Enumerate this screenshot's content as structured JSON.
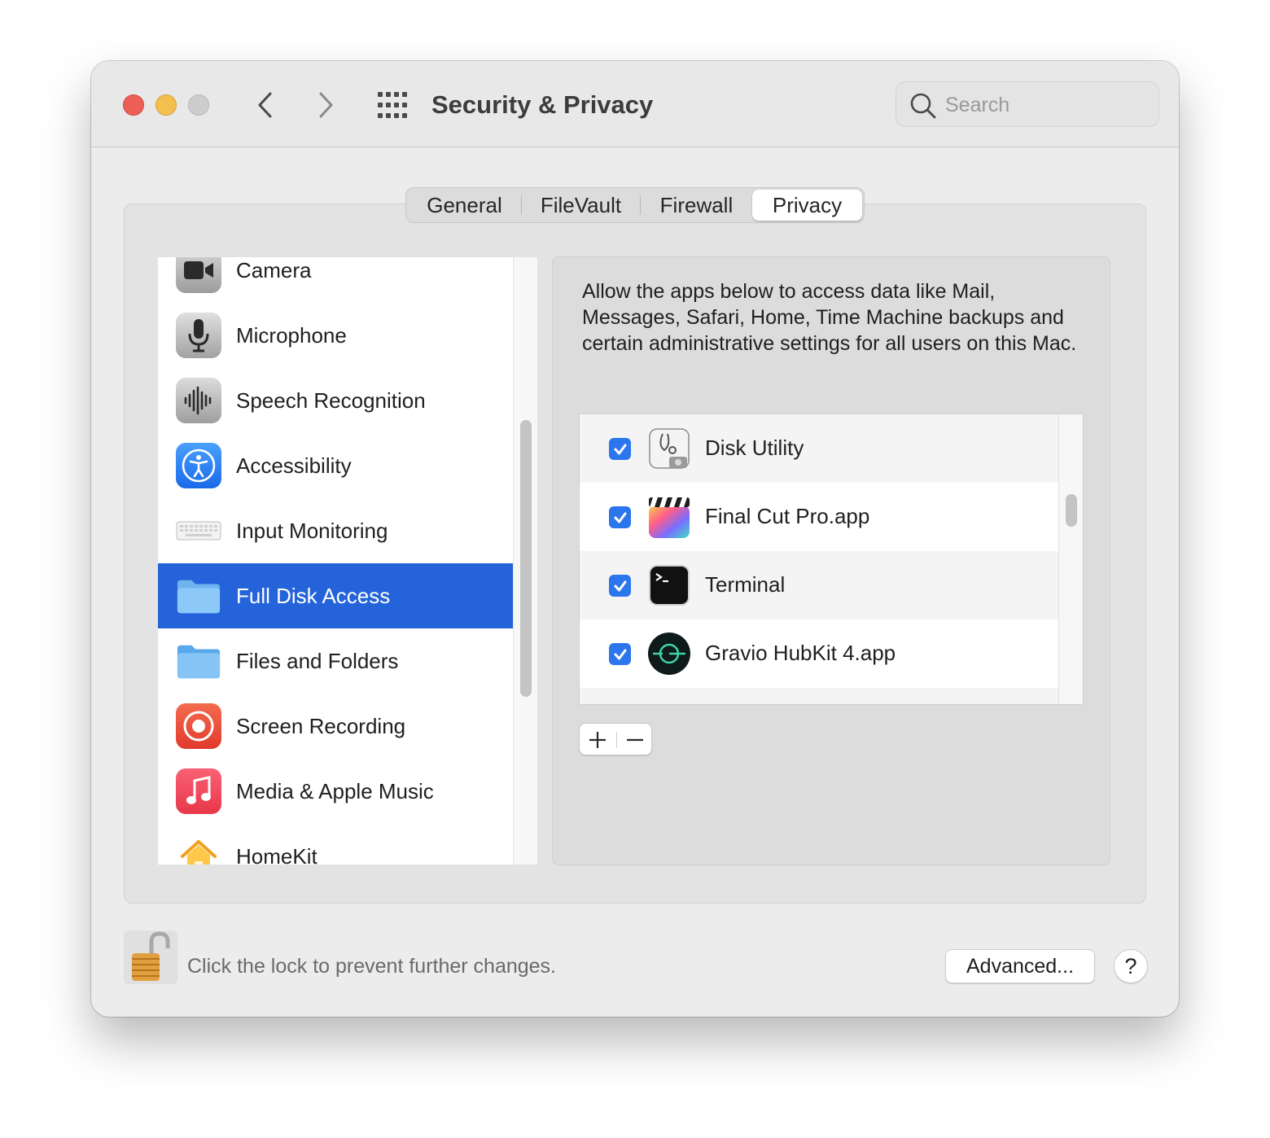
{
  "window": {
    "title": "Security & Privacy",
    "search_placeholder": "Search"
  },
  "tabs": [
    {
      "label": "General",
      "active": false
    },
    {
      "label": "FileVault",
      "active": false
    },
    {
      "label": "Firewall",
      "active": false
    },
    {
      "label": "Privacy",
      "active": true
    }
  ],
  "categories": [
    {
      "label": "Camera",
      "icon": "camera-icon"
    },
    {
      "label": "Microphone",
      "icon": "microphone-icon"
    },
    {
      "label": "Speech Recognition",
      "icon": "waveform-icon"
    },
    {
      "label": "Accessibility",
      "icon": "accessibility-icon"
    },
    {
      "label": "Input Monitoring",
      "icon": "keyboard-icon"
    },
    {
      "label": "Full Disk Access",
      "icon": "folder-icon",
      "selected": true
    },
    {
      "label": "Files and Folders",
      "icon": "folder-icon"
    },
    {
      "label": "Screen Recording",
      "icon": "screen-recording-icon"
    },
    {
      "label": "Media & Apple Music",
      "icon": "music-note-icon"
    },
    {
      "label": "HomeKit",
      "icon": "home-icon"
    }
  ],
  "panel": {
    "description": "Allow the apps below to access data like Mail, Messages, Safari, Home, Time Machine backups and certain administrative settings for all users on this Mac.",
    "apps": [
      {
        "label": "Disk Utility",
        "checked": true,
        "icon": "disk-utility-icon"
      },
      {
        "label": "Final Cut Pro.app",
        "checked": true,
        "icon": "final-cut-pro-icon"
      },
      {
        "label": "Terminal",
        "checked": true,
        "icon": "terminal-icon"
      },
      {
        "label": "Gravio HubKit 4.app",
        "checked": true,
        "icon": "gravio-icon"
      }
    ]
  },
  "footer": {
    "lock_text": "Click the lock to prevent further changes.",
    "advanced_label": "Advanced...",
    "help_label": "?"
  },
  "colors": {
    "accent": "#2463d9",
    "checkbox": "#2b76ec",
    "close": "#ec5f57",
    "minimize": "#f4bf4f"
  }
}
